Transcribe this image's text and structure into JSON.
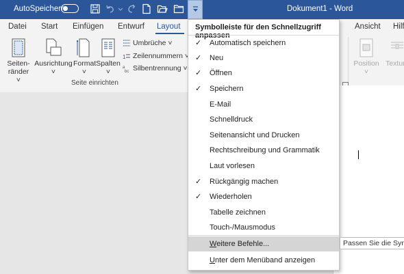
{
  "titlebar": {
    "autosave_label": "AutoSpeichern",
    "document_title": "Dokument1  -  Word"
  },
  "tabs": {
    "datei": "Datei",
    "start": "Start",
    "einfuegen": "Einfügen",
    "entwurf": "Entwurf",
    "layout": "Layout",
    "ansicht": "Ansicht",
    "hilfe": "Hilf"
  },
  "ribbon": {
    "seitenraender": "Seiten-\nränder",
    "ausrichtung": "Ausrichtung",
    "format": "Format",
    "spalten": "Spalten",
    "umbrueche": "Umbrüche",
    "zeilennummern": "Zeilennummern",
    "silbentrennung": "Silbentrennung",
    "group_label": "Seite einrichten",
    "position": "Position",
    "textumbruch": "Textum"
  },
  "menu": {
    "header": "Symbolleiste für den Schnellzugriff anpassen",
    "items": [
      {
        "label": "Automatisch speichern",
        "checked": "✓"
      },
      {
        "label": "Neu",
        "checked": "✓"
      },
      {
        "label": "Öffnen",
        "checked": "✓"
      },
      {
        "label": "Speichern",
        "checked": "✓"
      },
      {
        "label": "E-Mail",
        "checked": ""
      },
      {
        "label": "Schnelldruck",
        "checked": ""
      },
      {
        "label": "Seitenansicht und Drucken",
        "checked": ""
      },
      {
        "label": "Rechtschreibung und Grammatik",
        "checked": ""
      },
      {
        "label": "Laut vorlesen",
        "checked": ""
      },
      {
        "label": "Rückgängig machen",
        "checked": "✓"
      },
      {
        "label": "Wiederholen",
        "checked": "✓"
      },
      {
        "label": "Tabelle zeichnen",
        "checked": ""
      },
      {
        "label": "Touch-/Mausmodus",
        "checked": ""
      }
    ],
    "more_commands_prefix": "W",
    "more_commands_rest": "eitere Befehle...",
    "show_below_prefix": "U",
    "show_below_rest": "nter dem Menüband anzeigen"
  },
  "tooltip": {
    "text": "Passen Sie die Symbo"
  },
  "colors": {
    "titlebar": "#2b579a",
    "ribbon": "#f3f3f3",
    "menu_hover": "#d5d5d5"
  }
}
